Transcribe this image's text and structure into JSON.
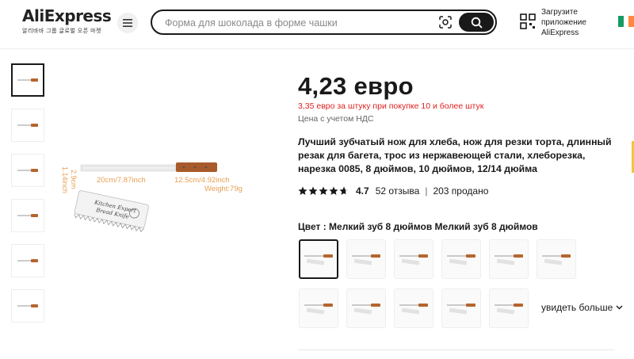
{
  "header": {
    "logo_text": "AliExpress",
    "logo_sub": "알리바바 그룹 글로벌 오픈 마켓",
    "search_placeholder": "Форма для шоколада в форме чашки",
    "app_promo": [
      "Загрузите",
      "приложение",
      "AliExpress"
    ],
    "menu_icon": "hamburger-icon",
    "camera_icon": "camera-search-icon",
    "search_icon": "magnifier-icon",
    "qr_icon": "qr-code-icon",
    "flag": [
      "#169b62",
      "#ffffff",
      "#ff883e"
    ]
  },
  "product": {
    "price": "4,23 евро",
    "bulk_price": "3,35 евро за штуку при покупке 10 и более штук",
    "vat_note": "Цена с учетом НДС",
    "title": "Лучший зубчатый нож для хлеба, нож для резки торта, длинный резак для багета, трос из нержавеющей стали, хлеборезка, нарезка 0085, 8 дюймов, 10 дюймов, 12/14 дюйма",
    "rating": 4.7,
    "rating_text": "4.7",
    "reviews": "52 отзыва",
    "separator": "|",
    "sold": "203 продано",
    "color_label": "Цвет : Мелкий зуб 8 дюймов Мелкий зуб 8 дюймов",
    "see_more": "увидеть больше",
    "star_color": "#191919"
  },
  "image_labels": {
    "height_cm": "2.9cm",
    "height_inch": "1.14inch",
    "blade_len": "20cm/7.87inch",
    "handle_len": "12.5cm/4.92inch",
    "weight": "Weight:79g",
    "sheath_line1": "Kitchen Expert",
    "sheath_line2": "Bread Knife",
    "label_color": "#e8a054"
  },
  "thumbnails_count": 6,
  "swatches_count": 11,
  "accent_color": "#e02020"
}
